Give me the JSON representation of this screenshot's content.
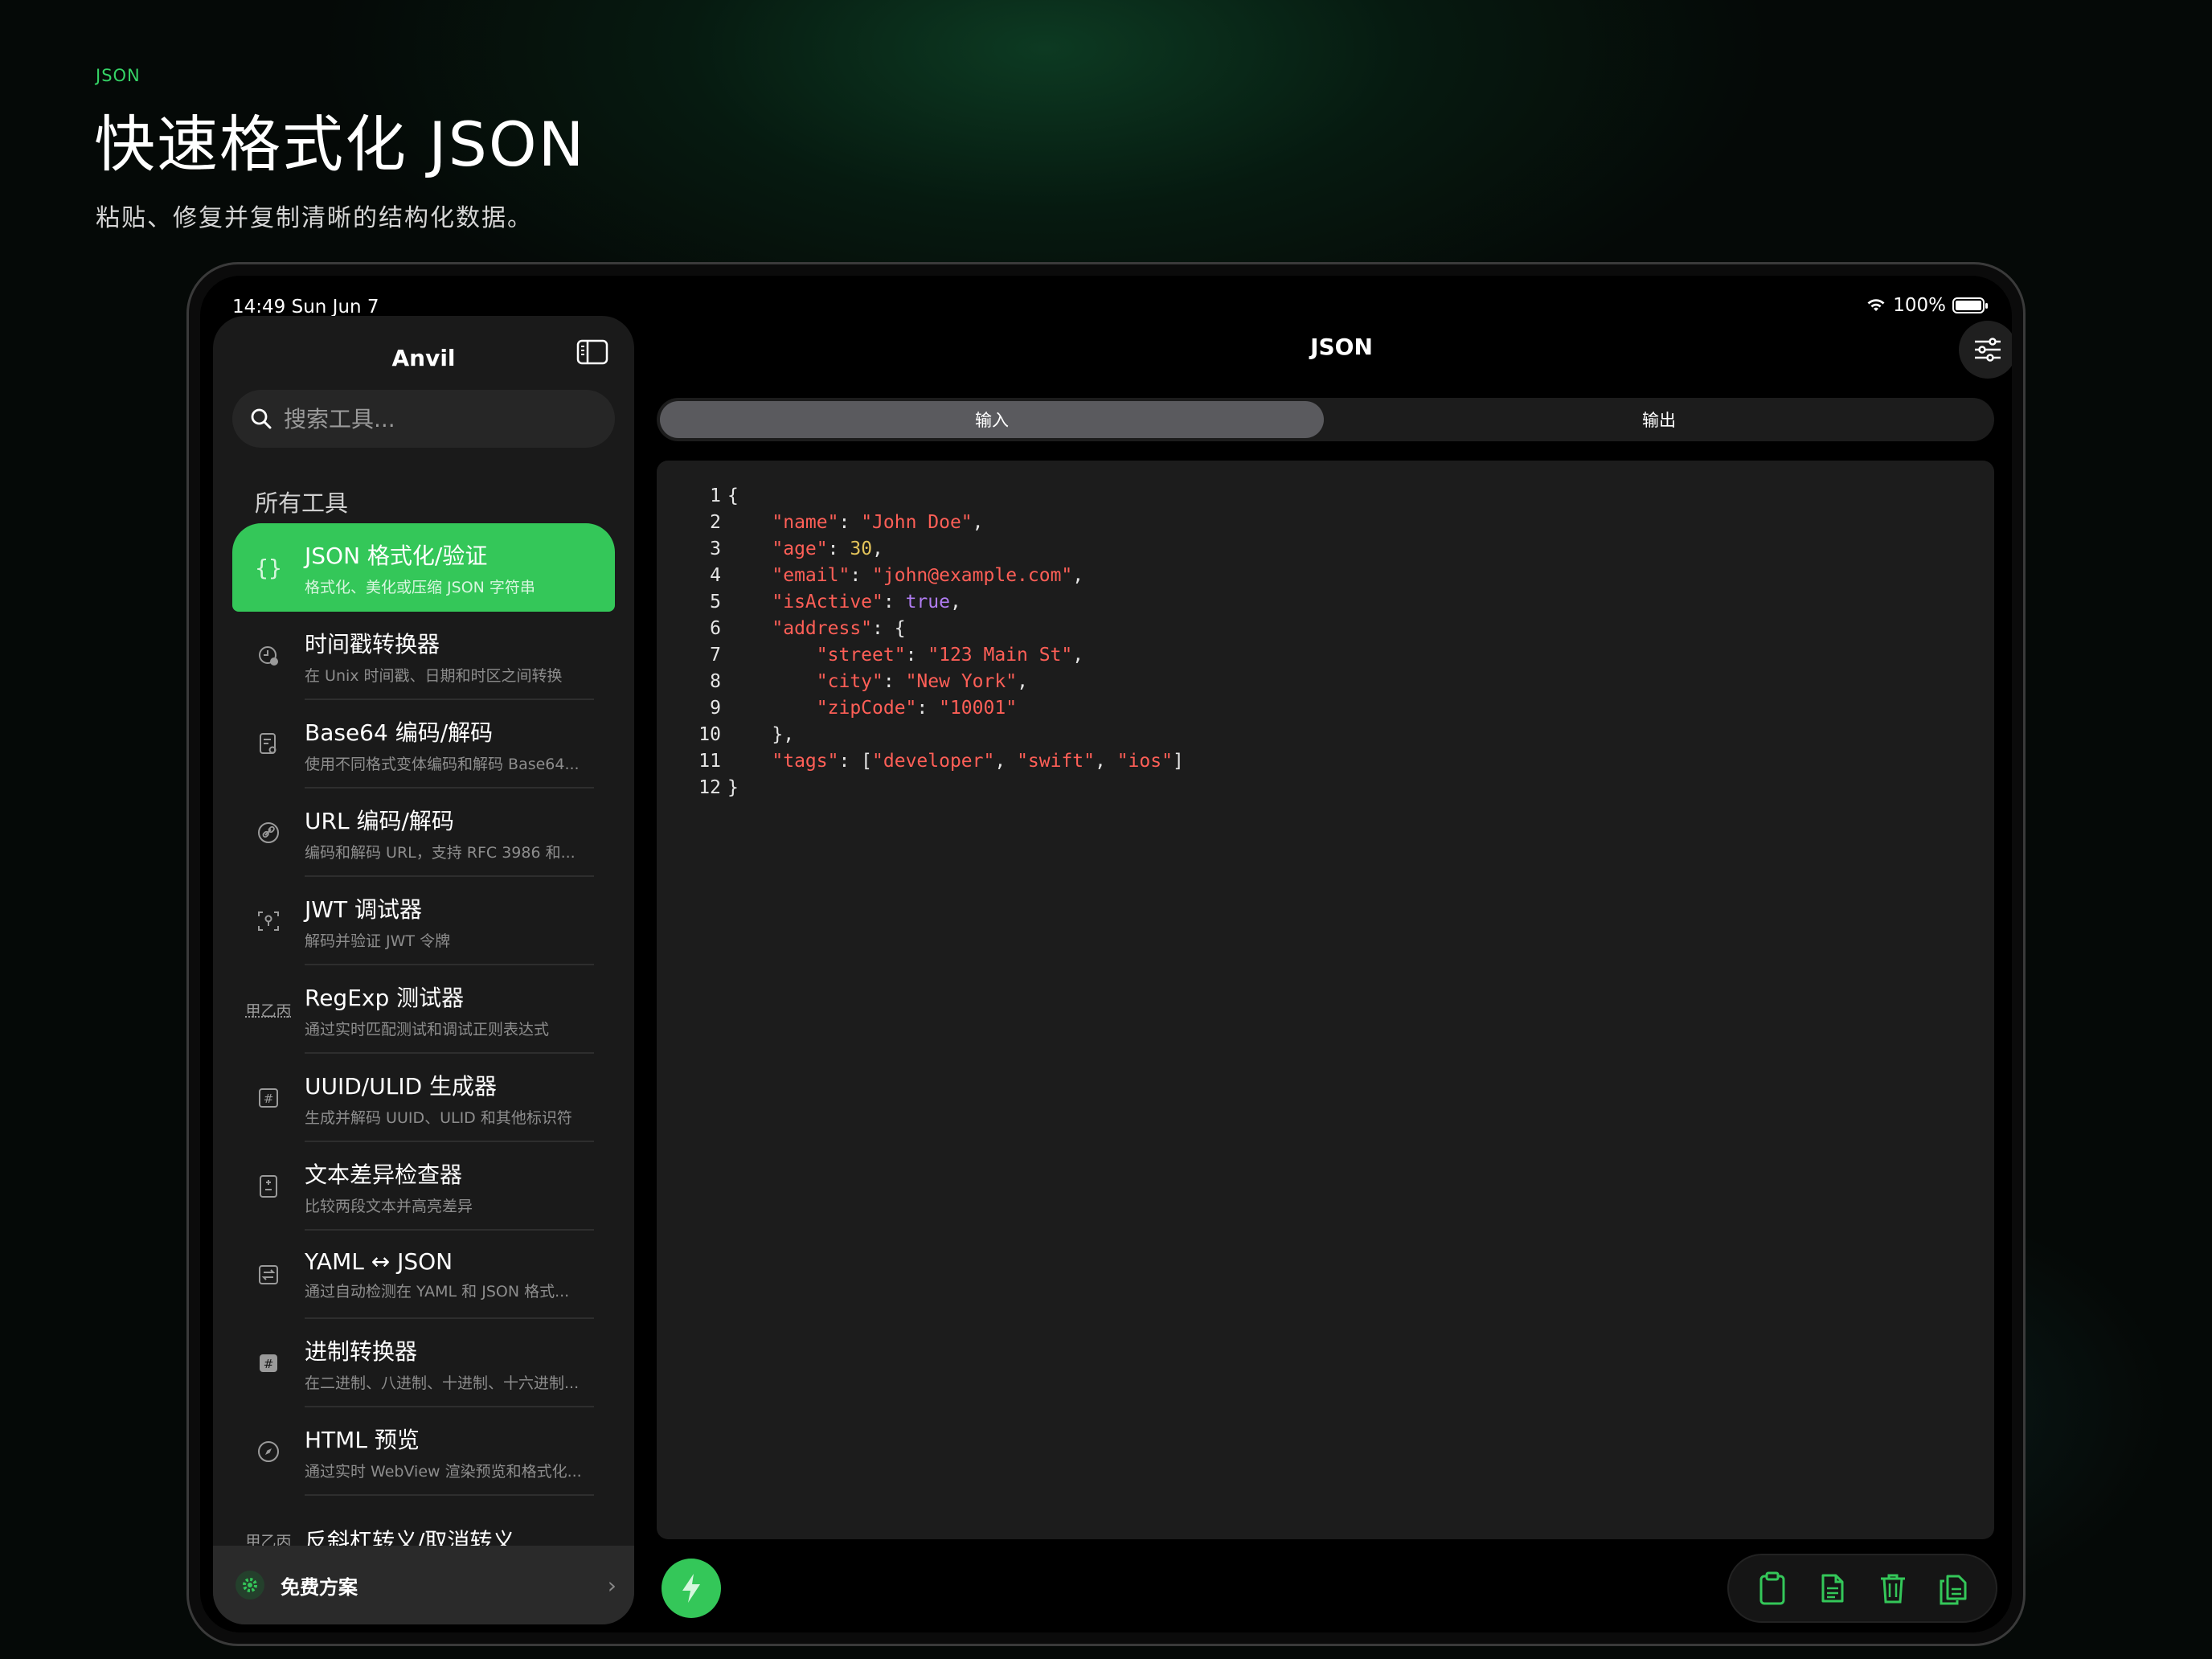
{
  "hero": {
    "eyebrow": "JSON",
    "headline": "快速格式化 JSON",
    "subline": "粘贴、修复并复制清晰的结构化数据。"
  },
  "status_bar": {
    "time": "14:49  Sun Jun 7",
    "battery": "100%"
  },
  "sidebar": {
    "title": "Anvil",
    "search_placeholder": "搜索工具...",
    "section_label": "所有工具",
    "items": [
      {
        "title": "JSON 格式化/验证",
        "desc": "格式化、美化或压缩 JSON 字符串",
        "icon": "braces-icon"
      },
      {
        "title": "时间戳转换器",
        "desc": "在 Unix 时间戳、日期和时区之间转换",
        "icon": "clock-icon"
      },
      {
        "title": "Base64 编码/解码",
        "desc": "使用不同格式变体编码和解码 Base64...",
        "icon": "document-search-icon"
      },
      {
        "title": "URL 编码/解码",
        "desc": "编码和解码 URL，支持 RFC 3986 和...",
        "icon": "link-icon"
      },
      {
        "title": "JWT 调试器",
        "desc": "解码并验证 JWT 令牌",
        "icon": "key-scan-icon"
      },
      {
        "title": "RegExp 测试器",
        "desc": "通过实时匹配测试和调试正则表达式",
        "icon": "text-pattern-icon",
        "glyph": "甲乙丙"
      },
      {
        "title": "UUID/ULID 生成器",
        "desc": "生成并解码 UUID、ULID 和其他标识符",
        "icon": "hash-box-icon"
      },
      {
        "title": "文本差异检查器",
        "desc": "比较两段文本并高亮差异",
        "icon": "diff-doc-icon"
      },
      {
        "title": "YAML ↔ JSON",
        "desc": "通过自动检测在 YAML 和 JSON 格式...",
        "icon": "convert-icon"
      },
      {
        "title": "进制转换器",
        "desc": "在二进制、八进制、十进制、十六进制...",
        "icon": "hash-filled-icon"
      },
      {
        "title": "HTML 预览",
        "desc": "通过实时 WebView 渲染预览和格式化...",
        "icon": "compass-icon"
      },
      {
        "title": "反斜杠转义/取消转义",
        "desc": "",
        "icon": "text-pattern-icon",
        "glyph": "甲乙丙"
      }
    ],
    "plan_label": "免费方案"
  },
  "main": {
    "title": "JSON",
    "tabs": [
      "输入",
      "输出"
    ],
    "selected_tab": "输入",
    "code_lines": [
      [
        {
          "c": "p",
          "t": "{"
        }
      ],
      [
        {
          "c": "p",
          "t": "    "
        },
        {
          "c": "k",
          "t": "\"name\""
        },
        {
          "c": "p",
          "t": ": "
        },
        {
          "c": "s",
          "t": "\"John Doe\""
        },
        {
          "c": "p",
          "t": ","
        }
      ],
      [
        {
          "c": "p",
          "t": "    "
        },
        {
          "c": "k",
          "t": "\"age\""
        },
        {
          "c": "p",
          "t": ": "
        },
        {
          "c": "n",
          "t": "30"
        },
        {
          "c": "p",
          "t": ","
        }
      ],
      [
        {
          "c": "p",
          "t": "    "
        },
        {
          "c": "k",
          "t": "\"email\""
        },
        {
          "c": "p",
          "t": ": "
        },
        {
          "c": "s",
          "t": "\"john@example.com\""
        },
        {
          "c": "p",
          "t": ","
        }
      ],
      [
        {
          "c": "p",
          "t": "    "
        },
        {
          "c": "k",
          "t": "\"isActive\""
        },
        {
          "c": "p",
          "t": ": "
        },
        {
          "c": "b",
          "t": "true"
        },
        {
          "c": "p",
          "t": ","
        }
      ],
      [
        {
          "c": "p",
          "t": "    "
        },
        {
          "c": "k",
          "t": "\"address\""
        },
        {
          "c": "p",
          "t": ": {"
        }
      ],
      [
        {
          "c": "p",
          "t": "        "
        },
        {
          "c": "k",
          "t": "\"street\""
        },
        {
          "c": "p",
          "t": ": "
        },
        {
          "c": "s",
          "t": "\"123 Main St\""
        },
        {
          "c": "p",
          "t": ","
        }
      ],
      [
        {
          "c": "p",
          "t": "        "
        },
        {
          "c": "k",
          "t": "\"city\""
        },
        {
          "c": "p",
          "t": ": "
        },
        {
          "c": "s",
          "t": "\"New York\""
        },
        {
          "c": "p",
          "t": ","
        }
      ],
      [
        {
          "c": "p",
          "t": "        "
        },
        {
          "c": "k",
          "t": "\"zipCode\""
        },
        {
          "c": "p",
          "t": ": "
        },
        {
          "c": "s",
          "t": "\"10001\""
        }
      ],
      [
        {
          "c": "p",
          "t": "    },"
        }
      ],
      [
        {
          "c": "p",
          "t": "    "
        },
        {
          "c": "k",
          "t": "\"tags\""
        },
        {
          "c": "p",
          "t": ": ["
        },
        {
          "c": "s",
          "t": "\"developer\""
        },
        {
          "c": "p",
          "t": ", "
        },
        {
          "c": "s",
          "t": "\"swift\""
        },
        {
          "c": "p",
          "t": ", "
        },
        {
          "c": "s",
          "t": "\"ios\""
        },
        {
          "c": "p",
          "t": "]"
        }
      ],
      [
        {
          "c": "p",
          "t": "}"
        }
      ]
    ],
    "actions": [
      "paste-icon",
      "document-icon",
      "trash-icon",
      "copy-icon"
    ]
  },
  "colors": {
    "accent": "#34c759",
    "json_key": "#ff5f57",
    "json_number": "#e3c35a",
    "json_boolean": "#b07cf2"
  }
}
